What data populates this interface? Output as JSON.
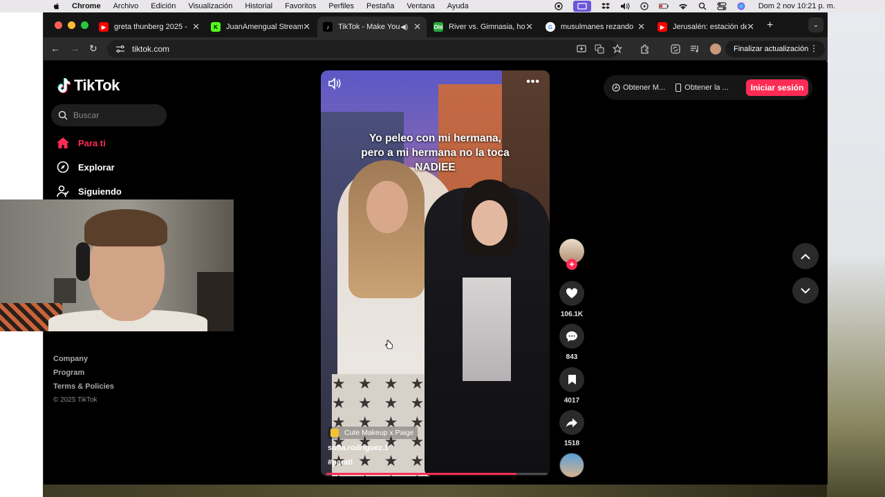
{
  "menubar": {
    "app": "Chrome",
    "items": [
      "Archivo",
      "Edición",
      "Visualización",
      "Historial",
      "Favoritos",
      "Perfiles",
      "Pestaña",
      "Ventana",
      "Ayuda"
    ],
    "clock": "Dom 2 nov  10:21 p. m."
  },
  "tabs": [
    {
      "title": "greta thunberg 2025 -",
      "icon": "youtube-icon",
      "color": "#ff0000"
    },
    {
      "title": "JuanAmengual Stream",
      "icon": "kick-icon",
      "color": "#53fc18"
    },
    {
      "title": "TikTok - Make Your",
      "icon": "tiktok-icon",
      "color": "#000000",
      "active": true
    },
    {
      "title": "River vs. Gimnasia, hoy",
      "icon": "ole-icon",
      "color": "#27a639"
    },
    {
      "title": "musulmanes rezando",
      "icon": "google-icon",
      "color": "#ffffff"
    },
    {
      "title": "Jerusalén: estación de",
      "icon": "youtube-icon",
      "color": "#ff0000"
    }
  ],
  "toolbar": {
    "url": "tiktok.com",
    "update_label": "Finalizar actualización"
  },
  "sidebar": {
    "logo": "TikTok",
    "search_placeholder": "Buscar",
    "nav": [
      {
        "label": "Para ti",
        "icon": "home-icon",
        "active": true
      },
      {
        "label": "Explorar",
        "icon": "compass-icon"
      },
      {
        "label": "Siguiendo",
        "icon": "following-icon"
      }
    ],
    "footer": {
      "company": "Company",
      "program": "Program",
      "terms": "Terms & Policies",
      "copyright": "© 2025 TikTok"
    }
  },
  "video": {
    "caption_line1": "Yo peleo con mi hermana,",
    "caption_line2": "pero a mi hermana no la toca",
    "caption_line3": "NADIEE",
    "music": "Cute Makeup x Paige",
    "author": "sofia.rodriguez.1",
    "hashtag": "#parati",
    "progress": 0.86
  },
  "actions": {
    "likes": "106.1K",
    "comments": "843",
    "saves": "4017",
    "shares": "1518"
  },
  "topright": {
    "get_app": "Obtener M...",
    "get_desktop": "Obtener la ...",
    "login": "Iniciar sesión"
  },
  "colors": {
    "accent": "#fe2c55",
    "background": "#000000"
  }
}
